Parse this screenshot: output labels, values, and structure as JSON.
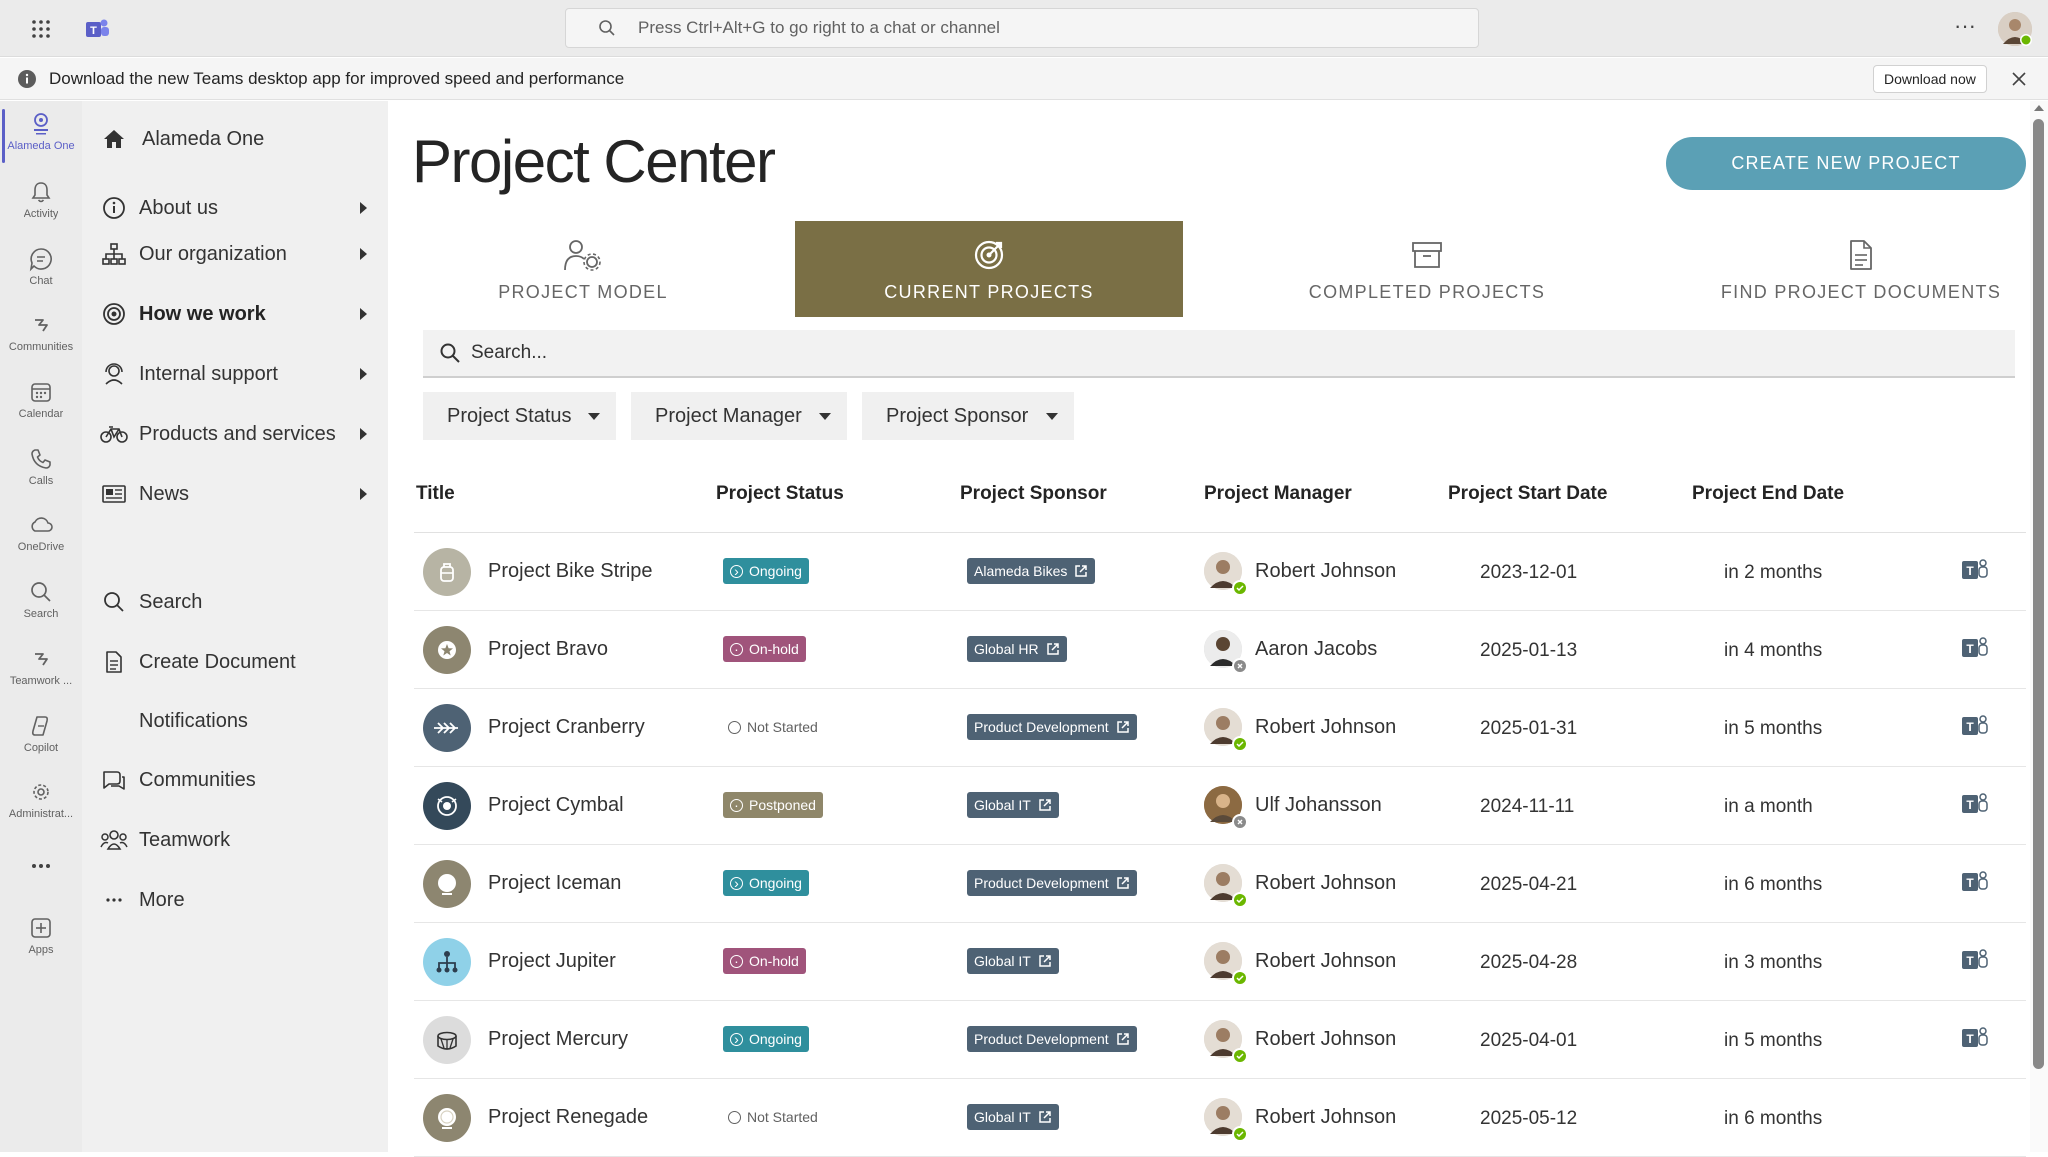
{
  "topbar": {
    "search_placeholder": "Press Ctrl+Alt+G to go right to a chat or channel",
    "more_label": "···"
  },
  "banner": {
    "message": "Download the new Teams desktop app for improved speed and performance",
    "button_label": "Download now"
  },
  "rail": {
    "items": [
      {
        "label": "Alameda One",
        "icon": "alameda-one-icon"
      },
      {
        "label": "Activity",
        "icon": "bell-icon"
      },
      {
        "label": "Chat",
        "icon": "chat-icon"
      },
      {
        "label": "Communities",
        "icon": "communities-icon"
      },
      {
        "label": "Calendar",
        "icon": "calendar-icon"
      },
      {
        "label": "Calls",
        "icon": "phone-icon"
      },
      {
        "label": "OneDrive",
        "icon": "cloud-icon"
      },
      {
        "label": "Search",
        "icon": "search-icon"
      },
      {
        "label": "Teamwork ...",
        "icon": "teamwork-icon"
      },
      {
        "label": "Copilot",
        "icon": "copilot-icon"
      },
      {
        "label": "Administrat...",
        "icon": "admin-icon"
      },
      {
        "label": "···",
        "icon": "more-icon"
      },
      {
        "label": "Apps",
        "icon": "apps-icon"
      }
    ]
  },
  "nav": {
    "items": [
      {
        "label": "Alameda One",
        "icon": "home-icon"
      },
      {
        "label": "About us",
        "icon": "info-icon"
      },
      {
        "label": "Our organization",
        "icon": "org-chart-icon"
      },
      {
        "label": "How we work",
        "icon": "target-icon"
      },
      {
        "label": "Internal support",
        "icon": "support-icon"
      },
      {
        "label": "Products and services",
        "icon": "bicycle-icon"
      },
      {
        "label": "News",
        "icon": "news-icon"
      },
      {
        "label": "Search",
        "icon": "search-icon"
      },
      {
        "label": "Create Document",
        "icon": "document-icon"
      },
      {
        "label": "Notifications",
        "icon": ""
      },
      {
        "label": "Communities",
        "icon": "communities-icon"
      },
      {
        "label": "Teamwork",
        "icon": "people-icon"
      },
      {
        "label": "More",
        "icon": "ellipsis-icon"
      }
    ]
  },
  "main": {
    "title": "Project Center",
    "create_button": "CREATE NEW PROJECT",
    "tabs": [
      {
        "label": "PROJECT MODEL",
        "icon": "project-model-icon"
      },
      {
        "label": "CURRENT PROJECTS",
        "icon": "target-arrow-icon"
      },
      {
        "label": "COMPLETED PROJECTS",
        "icon": "archive-icon"
      },
      {
        "label": "FIND PROJECT DOCUMENTS",
        "icon": "document-icon"
      }
    ],
    "search_placeholder": "Search...",
    "filters": [
      "Project Status",
      "Project Manager",
      "Project Sponsor"
    ],
    "columns": [
      "Title",
      "Project Status",
      "Project Sponsor",
      "Project Manager",
      "Project Start Date",
      "Project End Date"
    ],
    "rows": [
      {
        "title": "Project Bike Stripe",
        "status": "Ongoing",
        "sponsor": "Alameda Bikes",
        "manager": "Robert Johnson",
        "start": "2023-12-01",
        "end": "in 2 months"
      },
      {
        "title": "Project Bravo",
        "status": "On-hold",
        "sponsor": "Global HR",
        "manager": "Aaron Jacobs",
        "start": "2025-01-13",
        "end": "in 4 months"
      },
      {
        "title": "Project Cranberry",
        "status": "Not Started",
        "sponsor": "Product Development",
        "manager": "Robert Johnson",
        "start": "2025-01-31",
        "end": "in 5 months"
      },
      {
        "title": "Project Cymbal",
        "status": "Postponed",
        "sponsor": "Global IT",
        "manager": "Ulf Johansson",
        "start": "2024-11-11",
        "end": "in a month"
      },
      {
        "title": "Project Iceman",
        "status": "Ongoing",
        "sponsor": "Product Development",
        "manager": "Robert Johnson",
        "start": "2025-04-21",
        "end": "in 6 months"
      },
      {
        "title": "Project Jupiter",
        "status": "On-hold",
        "sponsor": "Global IT",
        "manager": "Robert Johnson",
        "start": "2025-04-28",
        "end": "in 3 months"
      },
      {
        "title": "Project Mercury",
        "status": "Ongoing",
        "sponsor": "Product Development",
        "manager": "Robert Johnson",
        "start": "2025-04-01",
        "end": "in 5 months"
      },
      {
        "title": "Project Renegade",
        "status": "Not Started",
        "sponsor": "Global IT",
        "manager": "Robert Johnson",
        "start": "2025-05-12",
        "end": "in 6 months"
      }
    ]
  },
  "colors": {
    "accent_tab": "#7a6f45",
    "create_button": "#5ba0b5",
    "status_ongoing": "#2f8f9d",
    "status_onhold": "#a0547b",
    "status_postponed": "#8f876a",
    "sponsor_badge": "#4e6274",
    "teams_purple": "#5b5fc7"
  }
}
